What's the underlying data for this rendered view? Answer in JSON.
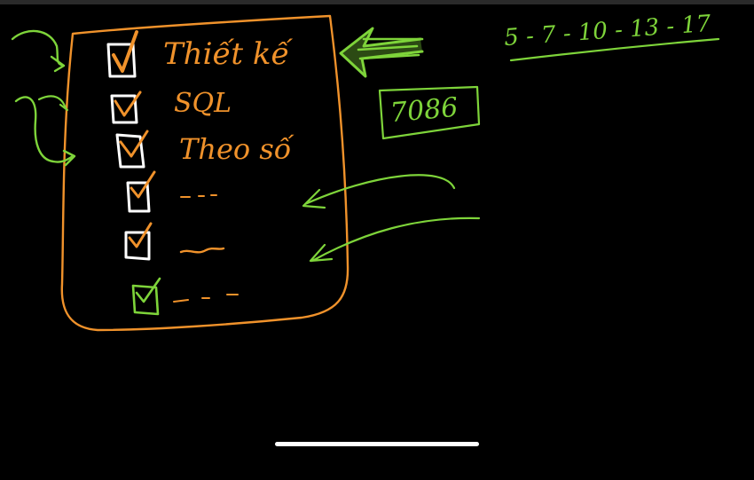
{
  "colors": {
    "background": "#000000",
    "orange": "#f0922b",
    "green": "#7ed43a",
    "white": "#ffffff"
  },
  "checklist": {
    "items": [
      {
        "label": "Thiết kế",
        "checked": true
      },
      {
        "label": "SQL",
        "checked": true
      },
      {
        "label": "Theo số",
        "checked": true
      },
      {
        "label": "- - -",
        "checked": true
      },
      {
        "label": "~",
        "checked": true
      },
      {
        "label": "- - -",
        "checked": true
      }
    ]
  },
  "notes": {
    "sequence": "5 - 7 - 10 - 13 - 17",
    "boxed_number": "7086"
  }
}
